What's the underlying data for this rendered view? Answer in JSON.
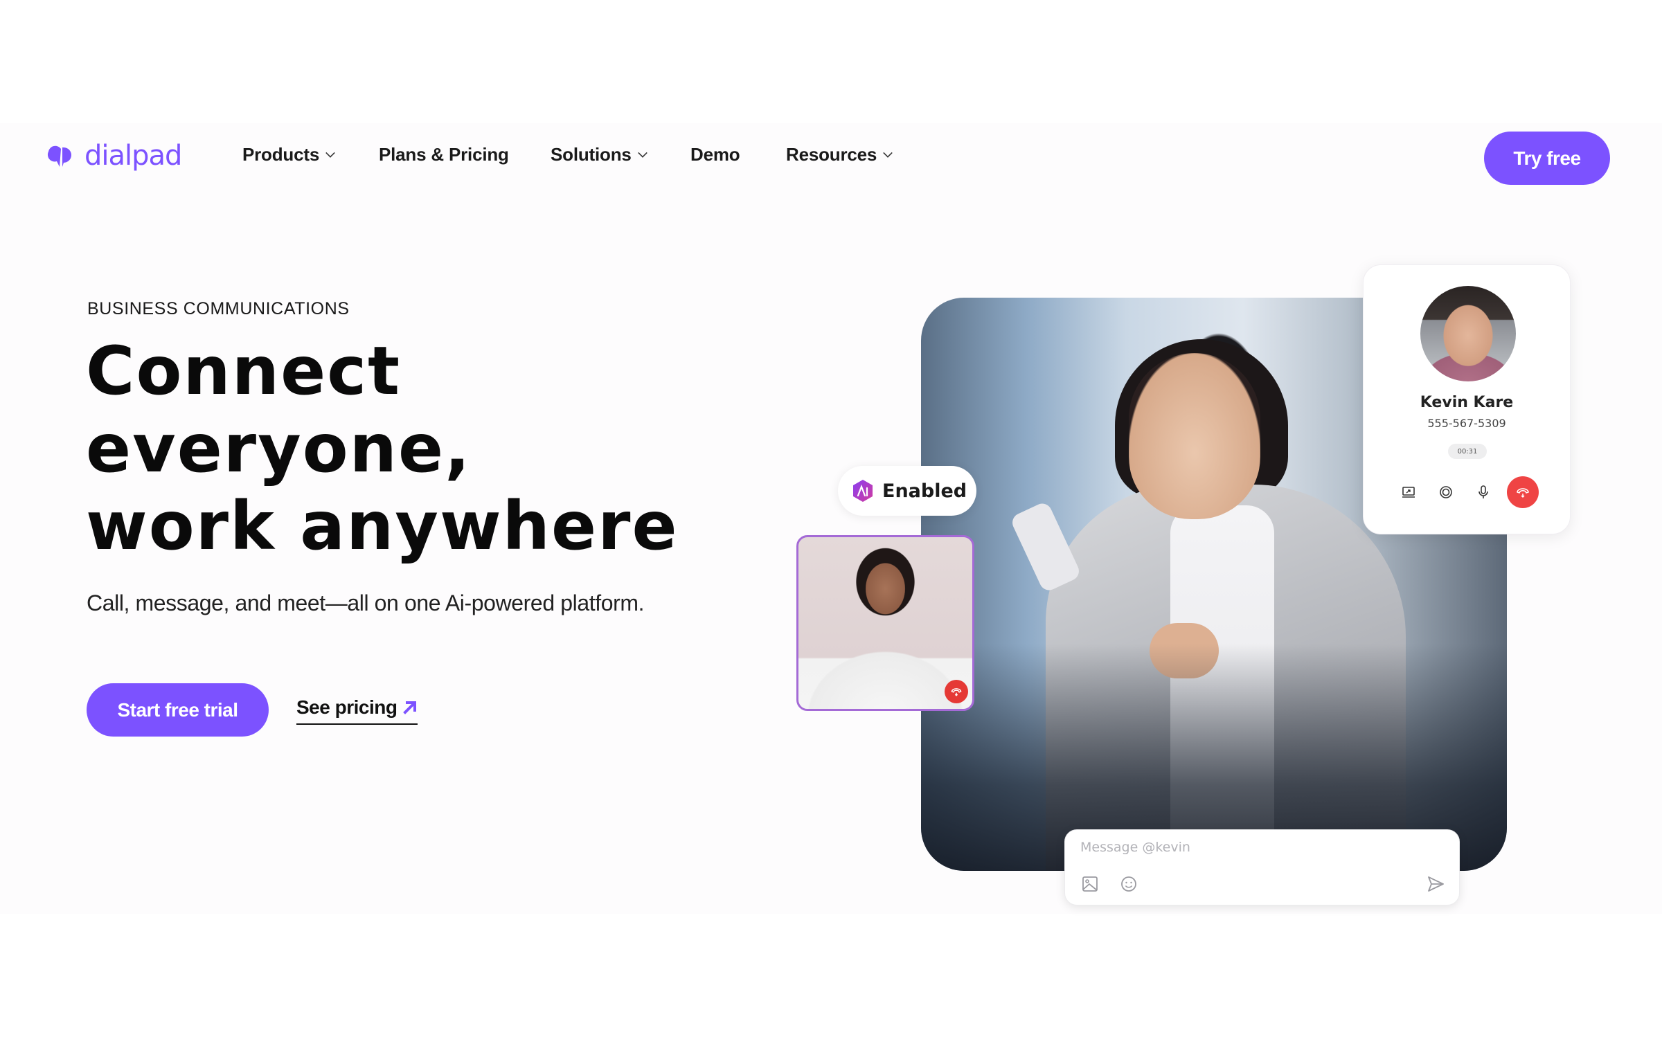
{
  "brand": {
    "name": "dialpad",
    "color": "#7c52ff"
  },
  "nav": {
    "items": [
      {
        "label": "Products",
        "has_dropdown": true
      },
      {
        "label": "Plans & Pricing",
        "has_dropdown": false
      },
      {
        "label": "Solutions",
        "has_dropdown": true
      },
      {
        "label": "Demo",
        "has_dropdown": false
      },
      {
        "label": "Resources",
        "has_dropdown": true
      }
    ],
    "cta_label": "Try free"
  },
  "hero": {
    "eyebrow": "BUSINESS COMMUNICATIONS",
    "headline_lines": [
      "Connect",
      "everyone,",
      "work anywhere"
    ],
    "subtitle": "Call, message, and meet—all on one Ai-powered platform.",
    "primary_cta": "Start free trial",
    "secondary_cta": "See pricing"
  },
  "visual": {
    "ai_badge": {
      "icon": "ai-hex-icon",
      "label": "Enabled"
    },
    "contact_card": {
      "name": "Kevin Kare",
      "phone": "555-567-5309",
      "call_timer": "00:31",
      "controls": [
        "screen-share-icon",
        "record-icon",
        "microphone-icon",
        "end-call-icon"
      ]
    },
    "video_thumbnail": {
      "controls": [
        "end-call-icon"
      ]
    },
    "message_box": {
      "placeholder": "Message @kevin",
      "value": "",
      "actions": [
        "image-icon",
        "emoji-icon",
        "send-icon"
      ]
    }
  },
  "colors": {
    "accent": "#7c52ff",
    "end_call": "#ef4444",
    "text": "#111111"
  }
}
